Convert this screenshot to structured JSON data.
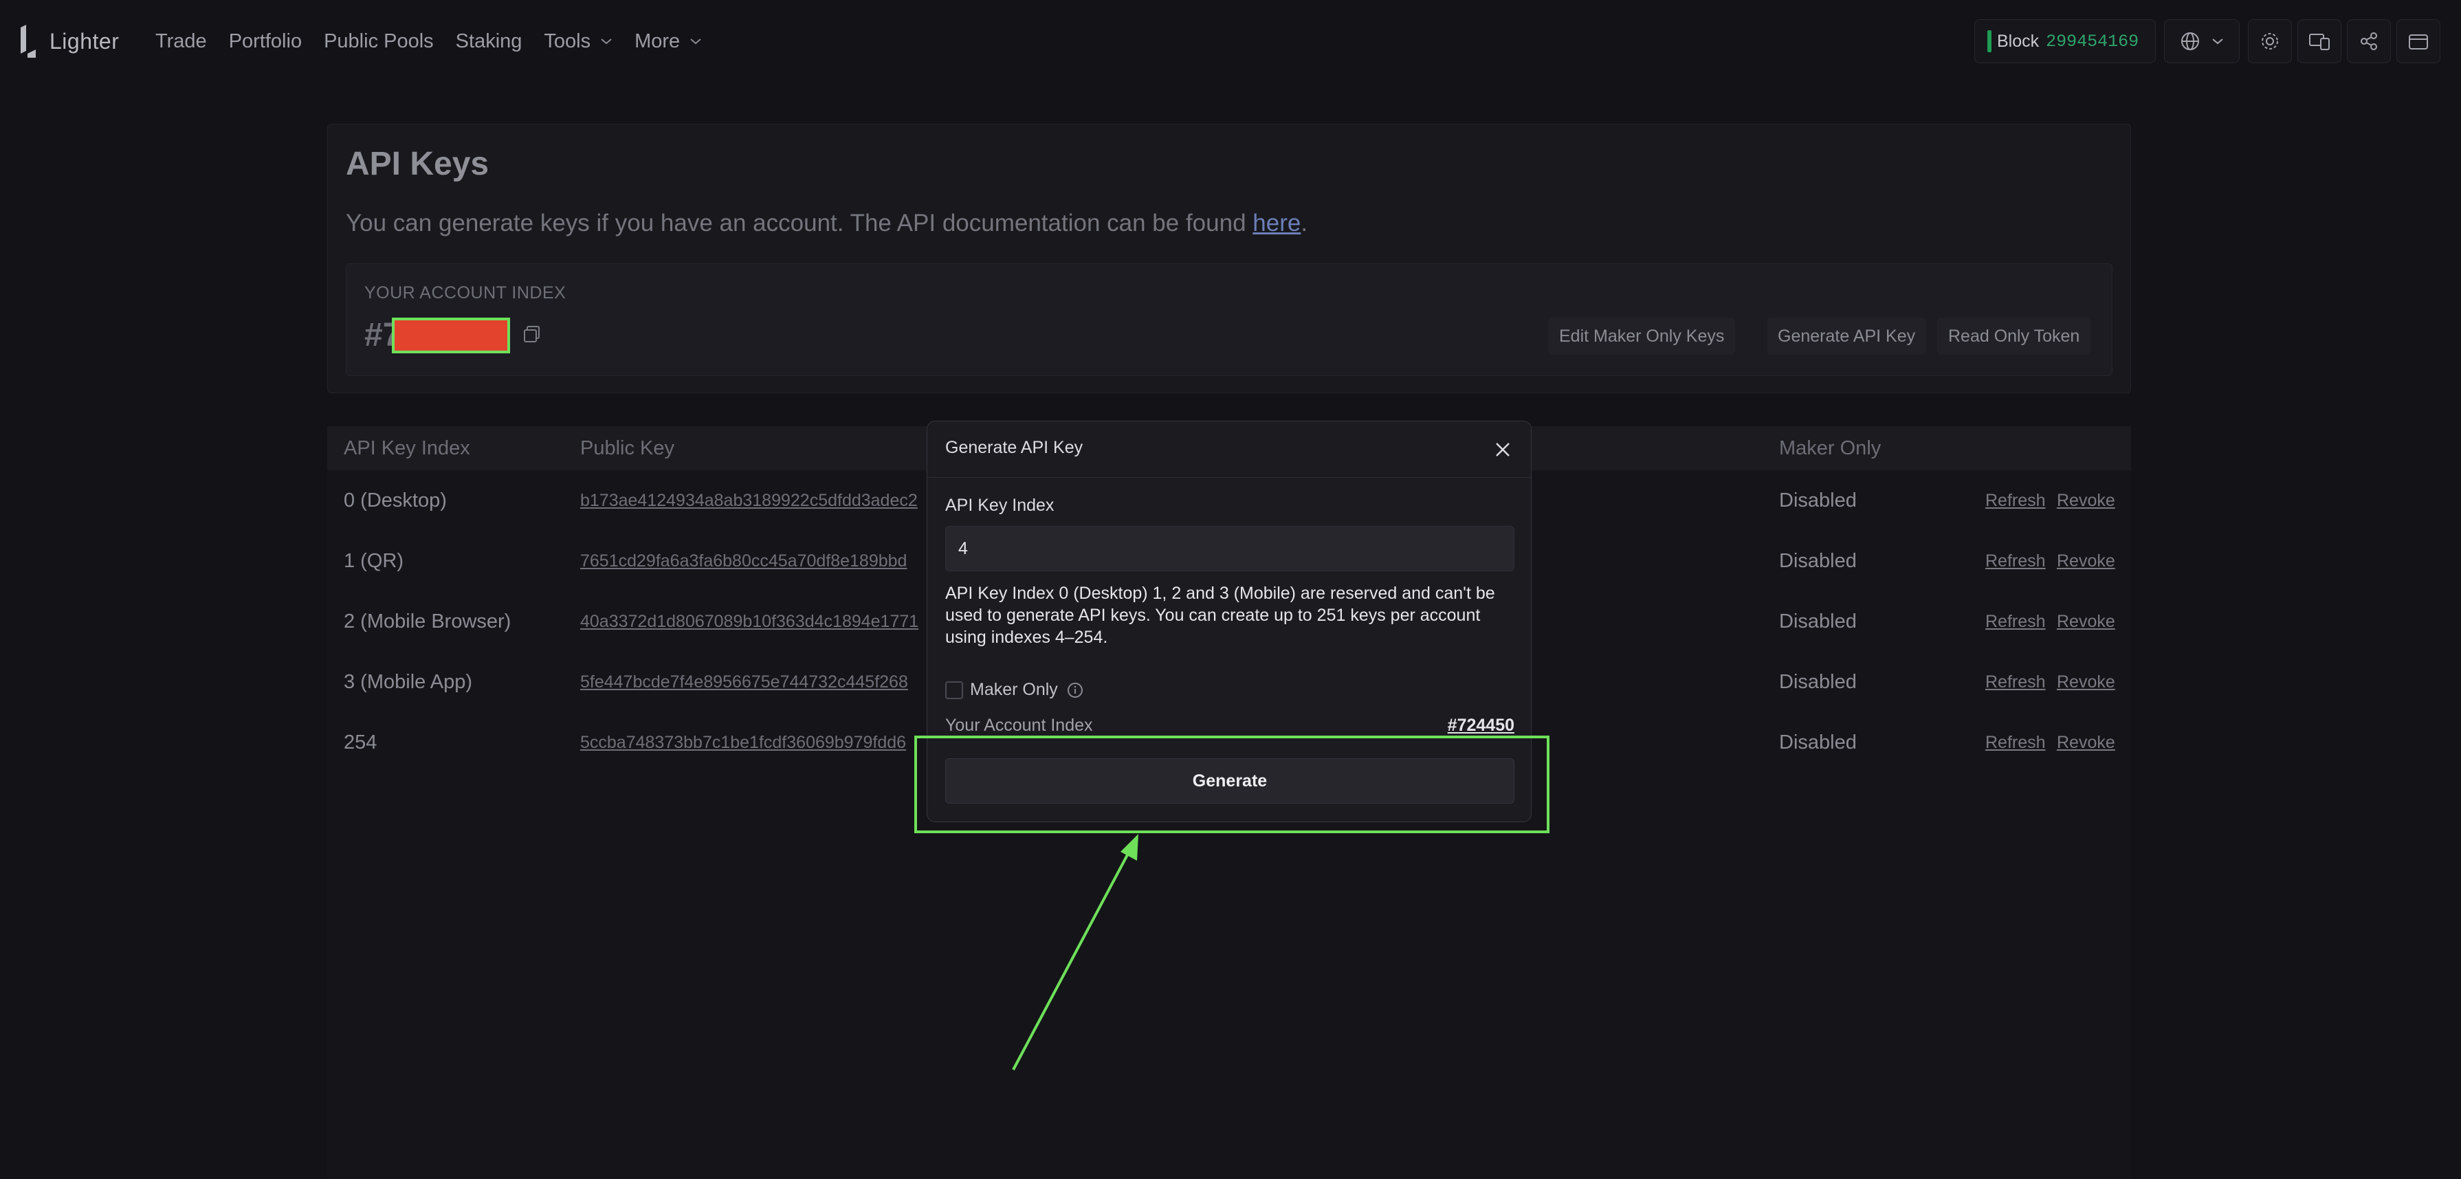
{
  "brand": {
    "name": "Lighter"
  },
  "nav": {
    "items": [
      {
        "label": "Trade",
        "dropdown": false
      },
      {
        "label": "Portfolio",
        "dropdown": false
      },
      {
        "label": "Public Pools",
        "dropdown": false
      },
      {
        "label": "Staking",
        "dropdown": false
      },
      {
        "label": "Tools",
        "dropdown": true
      },
      {
        "label": "More",
        "dropdown": true
      }
    ]
  },
  "status": {
    "block_label": "Block",
    "block_number": "299454169",
    "block_color": "#2fa56b"
  },
  "toolbar_icons": [
    "globe-icon",
    "gear-icon",
    "devices-icon",
    "share-icon",
    "wallet-icon"
  ],
  "page": {
    "title": "API Keys",
    "description": "You can generate keys if you have an account. The API documentation can be found ",
    "doc_link": "here",
    "description_end": ".",
    "account_label": "YOUR ACCOUNT INDEX",
    "account_prefix": "#7",
    "buttons": {
      "edit_maker": "Edit Maker Only Keys",
      "generate": "Generate API Key",
      "read_only": "Read Only Token"
    }
  },
  "table": {
    "headers": {
      "index": "API Key Index",
      "public_key": "Public Key",
      "maker_only": "Maker Only"
    },
    "rows": [
      {
        "index": "0 (Desktop)",
        "public_key": "b173ae4124934a8ab3189922c5dfdd3adec2",
        "maker_only": "Disabled",
        "refresh": "Refresh",
        "revoke": "Revoke"
      },
      {
        "index": "1 (QR)",
        "public_key": "7651cd29fa6a3fa6b80cc45a70df8e189bbd",
        "maker_only": "Disabled",
        "refresh": "Refresh",
        "revoke": "Revoke"
      },
      {
        "index": "2 (Mobile Browser)",
        "public_key": "40a3372d1d8067089b10f363d4c1894e1771",
        "maker_only": "Disabled",
        "refresh": "Refresh",
        "revoke": "Revoke"
      },
      {
        "index": "3 (Mobile App)",
        "public_key": "5fe447bcde7f4e8956675e744732c445f268",
        "maker_only": "Disabled",
        "refresh": "Refresh",
        "revoke": "Revoke"
      },
      {
        "index": "254",
        "public_key": "5ccba748373bb7c1be1fcdf36069b979fdd6",
        "maker_only": "Disabled",
        "refresh": "Refresh",
        "revoke": "Revoke"
      }
    ]
  },
  "modal": {
    "title": "Generate API Key",
    "index_label": "API Key Index",
    "index_value": "4",
    "note": "API Key Index 0 (Desktop) 1, 2 and 3 (Mobile) are reserved and can't be used to generate API keys. You can create up to 251 keys per account using indexes 4–254.",
    "maker_only_label": "Maker Only",
    "maker_only_checked": false,
    "account_label": "Your Account Index",
    "account_value": "#724450",
    "generate_label": "Generate"
  },
  "annotation": {
    "color": "#6ee05a",
    "redaction_color": "#e3432d"
  }
}
